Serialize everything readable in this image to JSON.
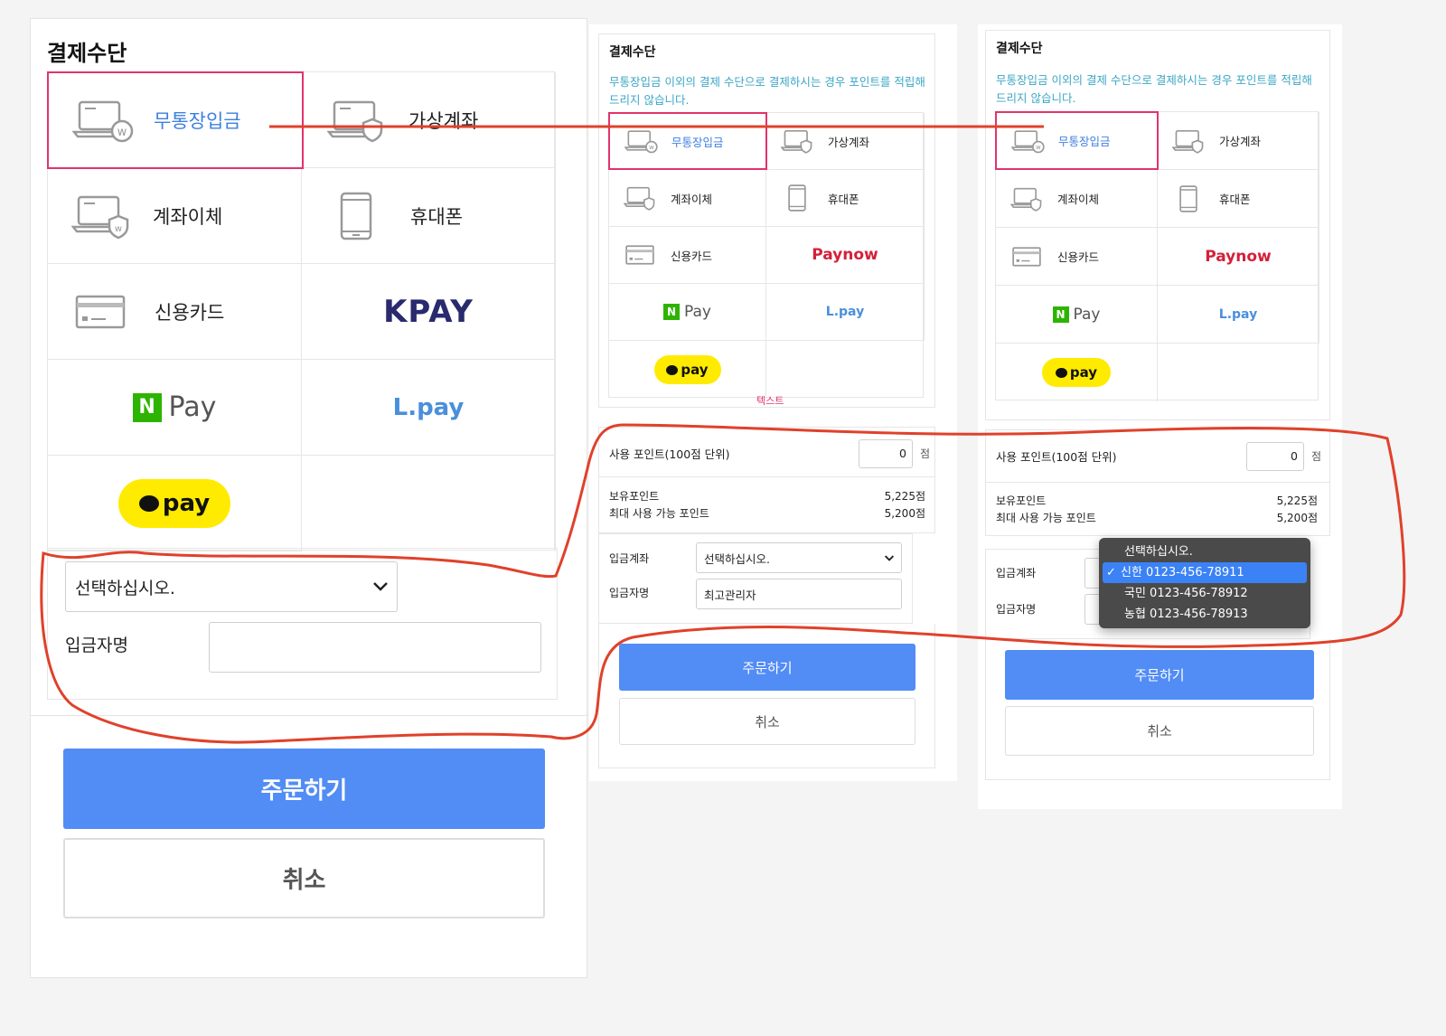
{
  "mockups": [
    {
      "title": "결제수단",
      "methods": [
        "무통장입금",
        "가상계좌",
        "계좌이체",
        "휴대폰",
        "신용카드",
        "KPAY",
        "Pay",
        "L.pay",
        "pay"
      ],
      "select_value": "선택하십시오.",
      "depositor_label": "입금자명",
      "order_button": "주문하기",
      "cancel_button": "취소"
    },
    {
      "title": "결제수단",
      "notice": "무통장입금 이외의 결제 수단으로 결제하시는 경우 포인트를 적립해드리지 않습니다.",
      "methods": [
        "무통장입금",
        "가상계좌",
        "계좌이체",
        "휴대폰",
        "신용카드",
        "Paynow",
        "Pay",
        "L.pay",
        "pay"
      ],
      "text_label": "텍스트",
      "points_label": "사용 포인트(100점 단위)",
      "points_value": "0",
      "points_unit": "점",
      "owned_label": "보유포인트",
      "owned_value": "5,225점",
      "max_label": "최대 사용 가능 포인트",
      "max_value": "5,200점",
      "account_label": "입금계좌",
      "account_value": "선택하십시오.",
      "depositor_label": "입금자명",
      "depositor_value": "최고관리자",
      "order_button": "주문하기",
      "cancel_button": "취소"
    },
    {
      "title": "결제수단",
      "notice": "무통장입금 이외의 결제 수단으로 결제하시는 경우 포인트를 적립해드리지 않습니다.",
      "methods": [
        "무통장입금",
        "가상계좌",
        "계좌이체",
        "휴대폰",
        "신용카드",
        "Paynow",
        "Pay",
        "L.pay",
        "pay"
      ],
      "points_label": "사용 포인트(100점 단위)",
      "points_value": "0",
      "points_unit": "점",
      "owned_label": "보유포인트",
      "owned_value": "5,225점",
      "max_label": "최대 사용 가능 포인트",
      "max_value": "5,200점",
      "account_label": "입금계좌",
      "depositor_label": "입금자명",
      "dropdown_options": [
        "선택하십시오.",
        "신한 0123-456-78911",
        "국민 0123-456-78912",
        "농협 0123-456-78913"
      ],
      "dropdown_selected_index": 1,
      "order_button": "주문하기",
      "cancel_button": "취소"
    }
  ],
  "colors": {
    "primary": "#528cf5",
    "selected_border": "#e2336b",
    "notice": "#3ba6c5",
    "annotation": "#e0412b",
    "npay_green": "#2db400",
    "kakao_yellow": "#ffeb00"
  },
  "icons": [
    "laptop-w-icon",
    "laptop-shield-icon",
    "phone-icon",
    "credit-card-icon",
    "chevron-down-icon",
    "checkmark-icon"
  ]
}
